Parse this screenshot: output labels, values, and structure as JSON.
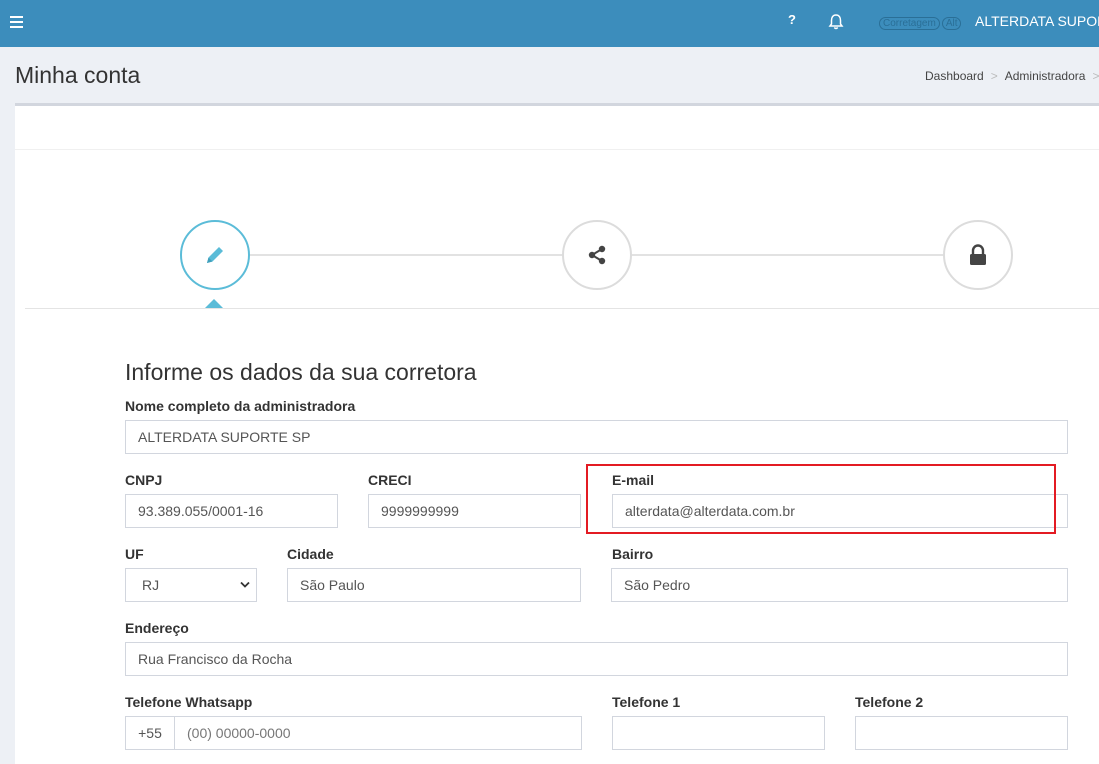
{
  "header": {
    "help_label": "?",
    "brand_text": "Corretagem",
    "brand_badge": "Alt",
    "user_name": "ALTERDATA SUPORTE SP"
  },
  "page": {
    "title": "Minha conta",
    "breadcrumb": [
      "Dashboard",
      ">",
      "Administradora",
      ">"
    ]
  },
  "steps": [
    {
      "icon": "pencil-icon",
      "active": true
    },
    {
      "icon": "share-icon",
      "active": false
    },
    {
      "icon": "lock-icon",
      "active": false
    }
  ],
  "form": {
    "title": "Informe os dados da sua corretora",
    "full_name": {
      "label": "Nome completo da administradora",
      "value": "ALTERDATA SUPORTE SP"
    },
    "cnpj": {
      "label": "CNPJ",
      "value": "93.389.055/0001-16"
    },
    "creci": {
      "label": "CRECI",
      "value": "9999999999"
    },
    "email": {
      "label": "E-mail",
      "value": "alterdata@alterdata.com.br"
    },
    "uf": {
      "label": "UF",
      "value": "RJ"
    },
    "cidade": {
      "label": "Cidade",
      "value": "São Paulo"
    },
    "bairro": {
      "label": "Bairro",
      "value": "São Pedro"
    },
    "endereco": {
      "label": "Endereço",
      "value": "Rua Francisco da Rocha"
    },
    "whatsapp": {
      "label": "Telefone Whatsapp",
      "prefix": "+55",
      "placeholder": "(00) 00000-0000"
    },
    "telefone1": {
      "label": "Telefone 1",
      "value": ""
    },
    "telefone2": {
      "label": "Telefone 2",
      "value": ""
    }
  },
  "colors": {
    "topbar": "#3c8dbc",
    "step_active": "#5bbcd8",
    "highlight": "#e31b23"
  }
}
